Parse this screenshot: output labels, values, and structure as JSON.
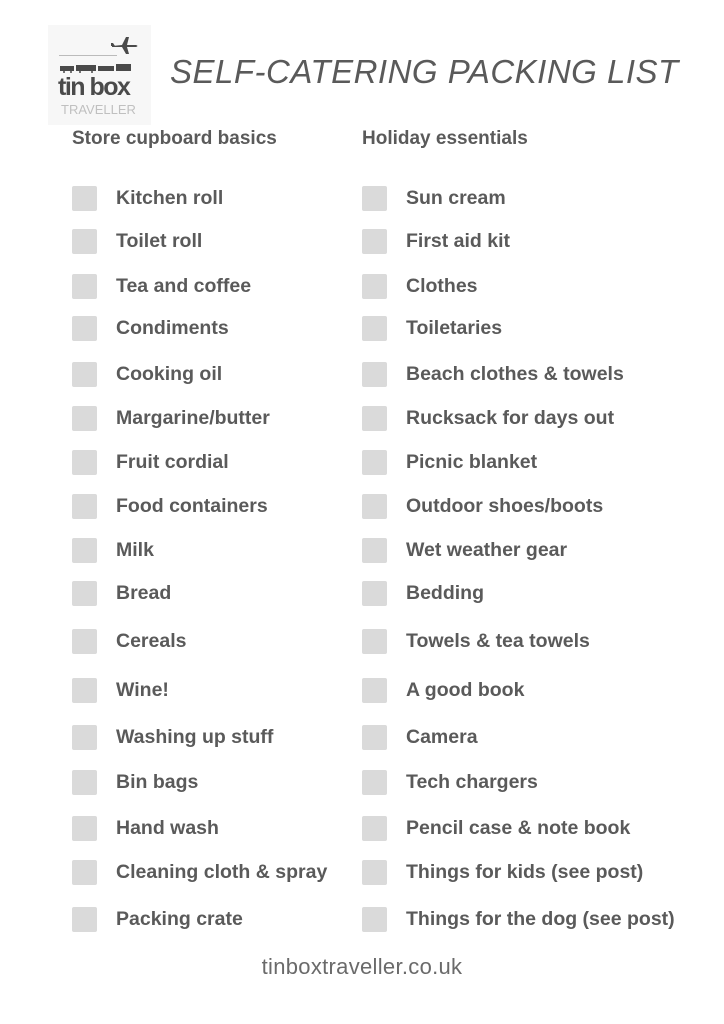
{
  "logo": {
    "brand": "tin box",
    "subtitle": "TRAVELLER",
    "icons": [
      "airplane-icon",
      "vehicles-icon"
    ]
  },
  "title": "SELF-CATERING PACKING LIST",
  "columns": [
    {
      "heading": "Store cupboard basics",
      "items": [
        "Kitchen roll",
        "Toilet roll",
        "Tea and coffee",
        "Condiments",
        "Cooking oil",
        "Margarine/butter",
        "Fruit cordial",
        "Food containers",
        "Milk",
        "Bread",
        "Cereals",
        "Wine!",
        "Washing up stuff",
        "Bin bags",
        "Hand wash",
        "Cleaning cloth & spray",
        "Packing crate"
      ]
    },
    {
      "heading": "Holiday essentials",
      "items": [
        "Sun cream",
        "First aid kit",
        "Clothes",
        "Toiletaries",
        "Beach clothes & towels",
        "Rucksack for days out",
        "Picnic blanket",
        "Outdoor shoes/boots",
        "Wet weather gear",
        "Bedding",
        "Towels & tea towels",
        "A good book",
        "Camera",
        "Tech chargers",
        "Pencil case & note book",
        "Things for kids (see post)",
        "Things for the dog (see post)"
      ]
    }
  ],
  "footer": "tinboxtraveller.co.uk"
}
